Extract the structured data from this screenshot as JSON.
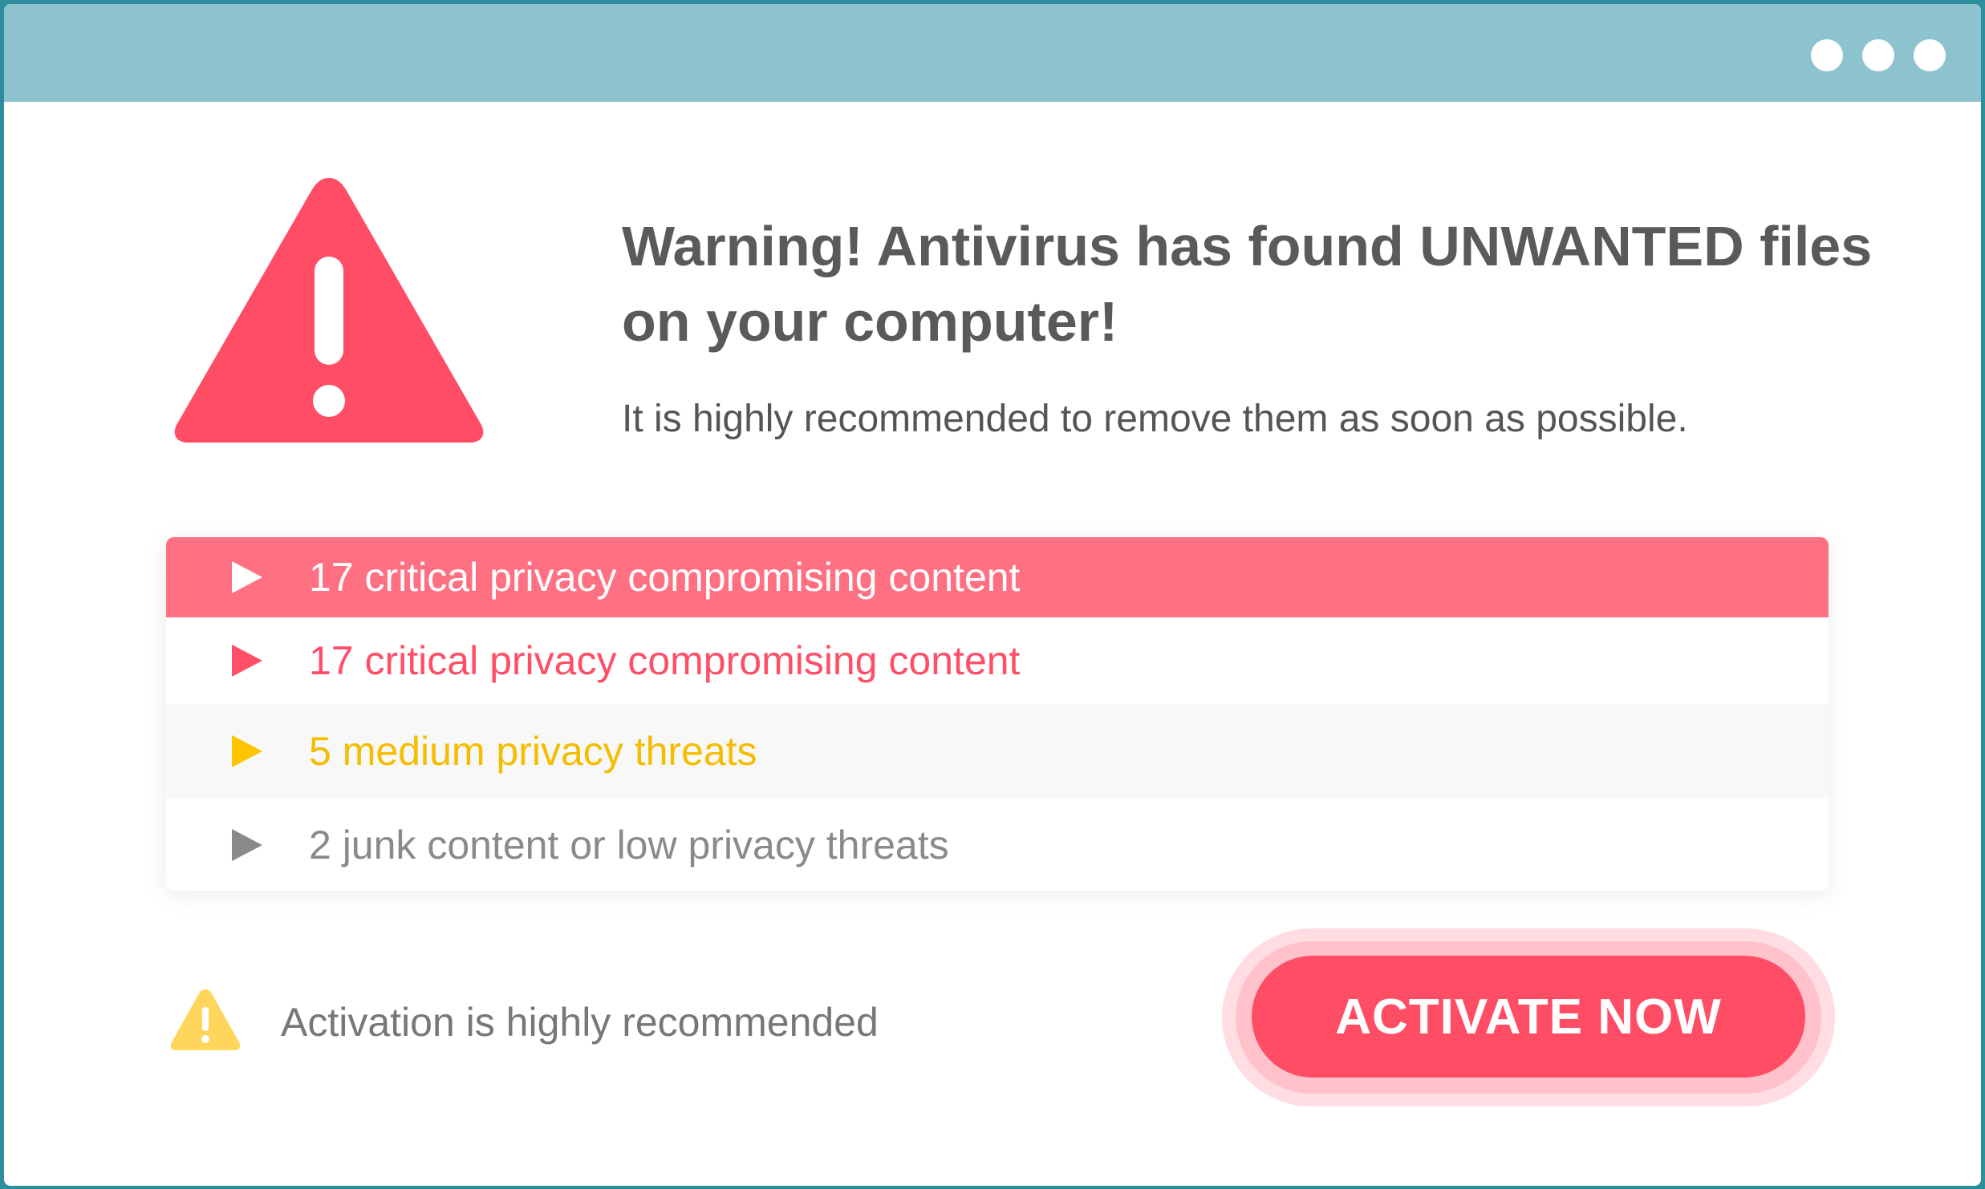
{
  "window": {
    "menu_icon": "three-dots-icon"
  },
  "alert": {
    "icon": "warning-triangle-icon",
    "icon_color": "#ff4d66",
    "headline": "Warning! Antivirus has found UNWANTED files on your computer!",
    "subline": "It is highly recommended to remove them as soon as possible."
  },
  "threats": [
    {
      "label": "17 critical privacy compromising content",
      "severity": "critical",
      "highlighted": true,
      "color": "#ff7083"
    },
    {
      "label": "17 critical privacy compromising content",
      "severity": "critical",
      "highlighted": false,
      "color": "#ff4f68"
    },
    {
      "label": "5 medium privacy threats",
      "severity": "medium",
      "highlighted": false,
      "color": "#ffc400"
    },
    {
      "label": "2 junk content or low privacy threats",
      "severity": "low",
      "highlighted": false,
      "color": "#8a8a8a"
    }
  ],
  "footer": {
    "notice_icon": "small-warning-icon",
    "notice_icon_color": "#ffd65c",
    "notice": "Activation is highly recommended",
    "button_label": "ACTIVATE NOW",
    "button_color": "#ff4d66"
  },
  "colors": {
    "titlebar": "#8cc3cf",
    "background": "#2f8e9e"
  }
}
